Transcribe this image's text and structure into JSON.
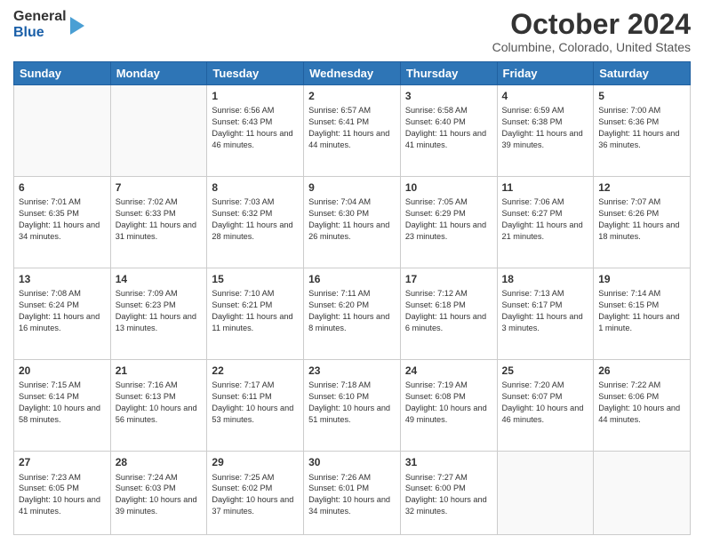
{
  "logo": {
    "line1": "General",
    "line2": "Blue"
  },
  "header": {
    "month": "October 2024",
    "location": "Columbine, Colorado, United States"
  },
  "weekdays": [
    "Sunday",
    "Monday",
    "Tuesday",
    "Wednesday",
    "Thursday",
    "Friday",
    "Saturday"
  ],
  "weeks": [
    [
      {
        "day": "",
        "sunrise": "",
        "sunset": "",
        "daylight": ""
      },
      {
        "day": "",
        "sunrise": "",
        "sunset": "",
        "daylight": ""
      },
      {
        "day": "1",
        "sunrise": "Sunrise: 6:56 AM",
        "sunset": "Sunset: 6:43 PM",
        "daylight": "Daylight: 11 hours and 46 minutes."
      },
      {
        "day": "2",
        "sunrise": "Sunrise: 6:57 AM",
        "sunset": "Sunset: 6:41 PM",
        "daylight": "Daylight: 11 hours and 44 minutes."
      },
      {
        "day": "3",
        "sunrise": "Sunrise: 6:58 AM",
        "sunset": "Sunset: 6:40 PM",
        "daylight": "Daylight: 11 hours and 41 minutes."
      },
      {
        "day": "4",
        "sunrise": "Sunrise: 6:59 AM",
        "sunset": "Sunset: 6:38 PM",
        "daylight": "Daylight: 11 hours and 39 minutes."
      },
      {
        "day": "5",
        "sunrise": "Sunrise: 7:00 AM",
        "sunset": "Sunset: 6:36 PM",
        "daylight": "Daylight: 11 hours and 36 minutes."
      }
    ],
    [
      {
        "day": "6",
        "sunrise": "Sunrise: 7:01 AM",
        "sunset": "Sunset: 6:35 PM",
        "daylight": "Daylight: 11 hours and 34 minutes."
      },
      {
        "day": "7",
        "sunrise": "Sunrise: 7:02 AM",
        "sunset": "Sunset: 6:33 PM",
        "daylight": "Daylight: 11 hours and 31 minutes."
      },
      {
        "day": "8",
        "sunrise": "Sunrise: 7:03 AM",
        "sunset": "Sunset: 6:32 PM",
        "daylight": "Daylight: 11 hours and 28 minutes."
      },
      {
        "day": "9",
        "sunrise": "Sunrise: 7:04 AM",
        "sunset": "Sunset: 6:30 PM",
        "daylight": "Daylight: 11 hours and 26 minutes."
      },
      {
        "day": "10",
        "sunrise": "Sunrise: 7:05 AM",
        "sunset": "Sunset: 6:29 PM",
        "daylight": "Daylight: 11 hours and 23 minutes."
      },
      {
        "day": "11",
        "sunrise": "Sunrise: 7:06 AM",
        "sunset": "Sunset: 6:27 PM",
        "daylight": "Daylight: 11 hours and 21 minutes."
      },
      {
        "day": "12",
        "sunrise": "Sunrise: 7:07 AM",
        "sunset": "Sunset: 6:26 PM",
        "daylight": "Daylight: 11 hours and 18 minutes."
      }
    ],
    [
      {
        "day": "13",
        "sunrise": "Sunrise: 7:08 AM",
        "sunset": "Sunset: 6:24 PM",
        "daylight": "Daylight: 11 hours and 16 minutes."
      },
      {
        "day": "14",
        "sunrise": "Sunrise: 7:09 AM",
        "sunset": "Sunset: 6:23 PM",
        "daylight": "Daylight: 11 hours and 13 minutes."
      },
      {
        "day": "15",
        "sunrise": "Sunrise: 7:10 AM",
        "sunset": "Sunset: 6:21 PM",
        "daylight": "Daylight: 11 hours and 11 minutes."
      },
      {
        "day": "16",
        "sunrise": "Sunrise: 7:11 AM",
        "sunset": "Sunset: 6:20 PM",
        "daylight": "Daylight: 11 hours and 8 minutes."
      },
      {
        "day": "17",
        "sunrise": "Sunrise: 7:12 AM",
        "sunset": "Sunset: 6:18 PM",
        "daylight": "Daylight: 11 hours and 6 minutes."
      },
      {
        "day": "18",
        "sunrise": "Sunrise: 7:13 AM",
        "sunset": "Sunset: 6:17 PM",
        "daylight": "Daylight: 11 hours and 3 minutes."
      },
      {
        "day": "19",
        "sunrise": "Sunrise: 7:14 AM",
        "sunset": "Sunset: 6:15 PM",
        "daylight": "Daylight: 11 hours and 1 minute."
      }
    ],
    [
      {
        "day": "20",
        "sunrise": "Sunrise: 7:15 AM",
        "sunset": "Sunset: 6:14 PM",
        "daylight": "Daylight: 10 hours and 58 minutes."
      },
      {
        "day": "21",
        "sunrise": "Sunrise: 7:16 AM",
        "sunset": "Sunset: 6:13 PM",
        "daylight": "Daylight: 10 hours and 56 minutes."
      },
      {
        "day": "22",
        "sunrise": "Sunrise: 7:17 AM",
        "sunset": "Sunset: 6:11 PM",
        "daylight": "Daylight: 10 hours and 53 minutes."
      },
      {
        "day": "23",
        "sunrise": "Sunrise: 7:18 AM",
        "sunset": "Sunset: 6:10 PM",
        "daylight": "Daylight: 10 hours and 51 minutes."
      },
      {
        "day": "24",
        "sunrise": "Sunrise: 7:19 AM",
        "sunset": "Sunset: 6:08 PM",
        "daylight": "Daylight: 10 hours and 49 minutes."
      },
      {
        "day": "25",
        "sunrise": "Sunrise: 7:20 AM",
        "sunset": "Sunset: 6:07 PM",
        "daylight": "Daylight: 10 hours and 46 minutes."
      },
      {
        "day": "26",
        "sunrise": "Sunrise: 7:22 AM",
        "sunset": "Sunset: 6:06 PM",
        "daylight": "Daylight: 10 hours and 44 minutes."
      }
    ],
    [
      {
        "day": "27",
        "sunrise": "Sunrise: 7:23 AM",
        "sunset": "Sunset: 6:05 PM",
        "daylight": "Daylight: 10 hours and 41 minutes."
      },
      {
        "day": "28",
        "sunrise": "Sunrise: 7:24 AM",
        "sunset": "Sunset: 6:03 PM",
        "daylight": "Daylight: 10 hours and 39 minutes."
      },
      {
        "day": "29",
        "sunrise": "Sunrise: 7:25 AM",
        "sunset": "Sunset: 6:02 PM",
        "daylight": "Daylight: 10 hours and 37 minutes."
      },
      {
        "day": "30",
        "sunrise": "Sunrise: 7:26 AM",
        "sunset": "Sunset: 6:01 PM",
        "daylight": "Daylight: 10 hours and 34 minutes."
      },
      {
        "day": "31",
        "sunrise": "Sunrise: 7:27 AM",
        "sunset": "Sunset: 6:00 PM",
        "daylight": "Daylight: 10 hours and 32 minutes."
      },
      {
        "day": "",
        "sunrise": "",
        "sunset": "",
        "daylight": ""
      },
      {
        "day": "",
        "sunrise": "",
        "sunset": "",
        "daylight": ""
      }
    ]
  ]
}
